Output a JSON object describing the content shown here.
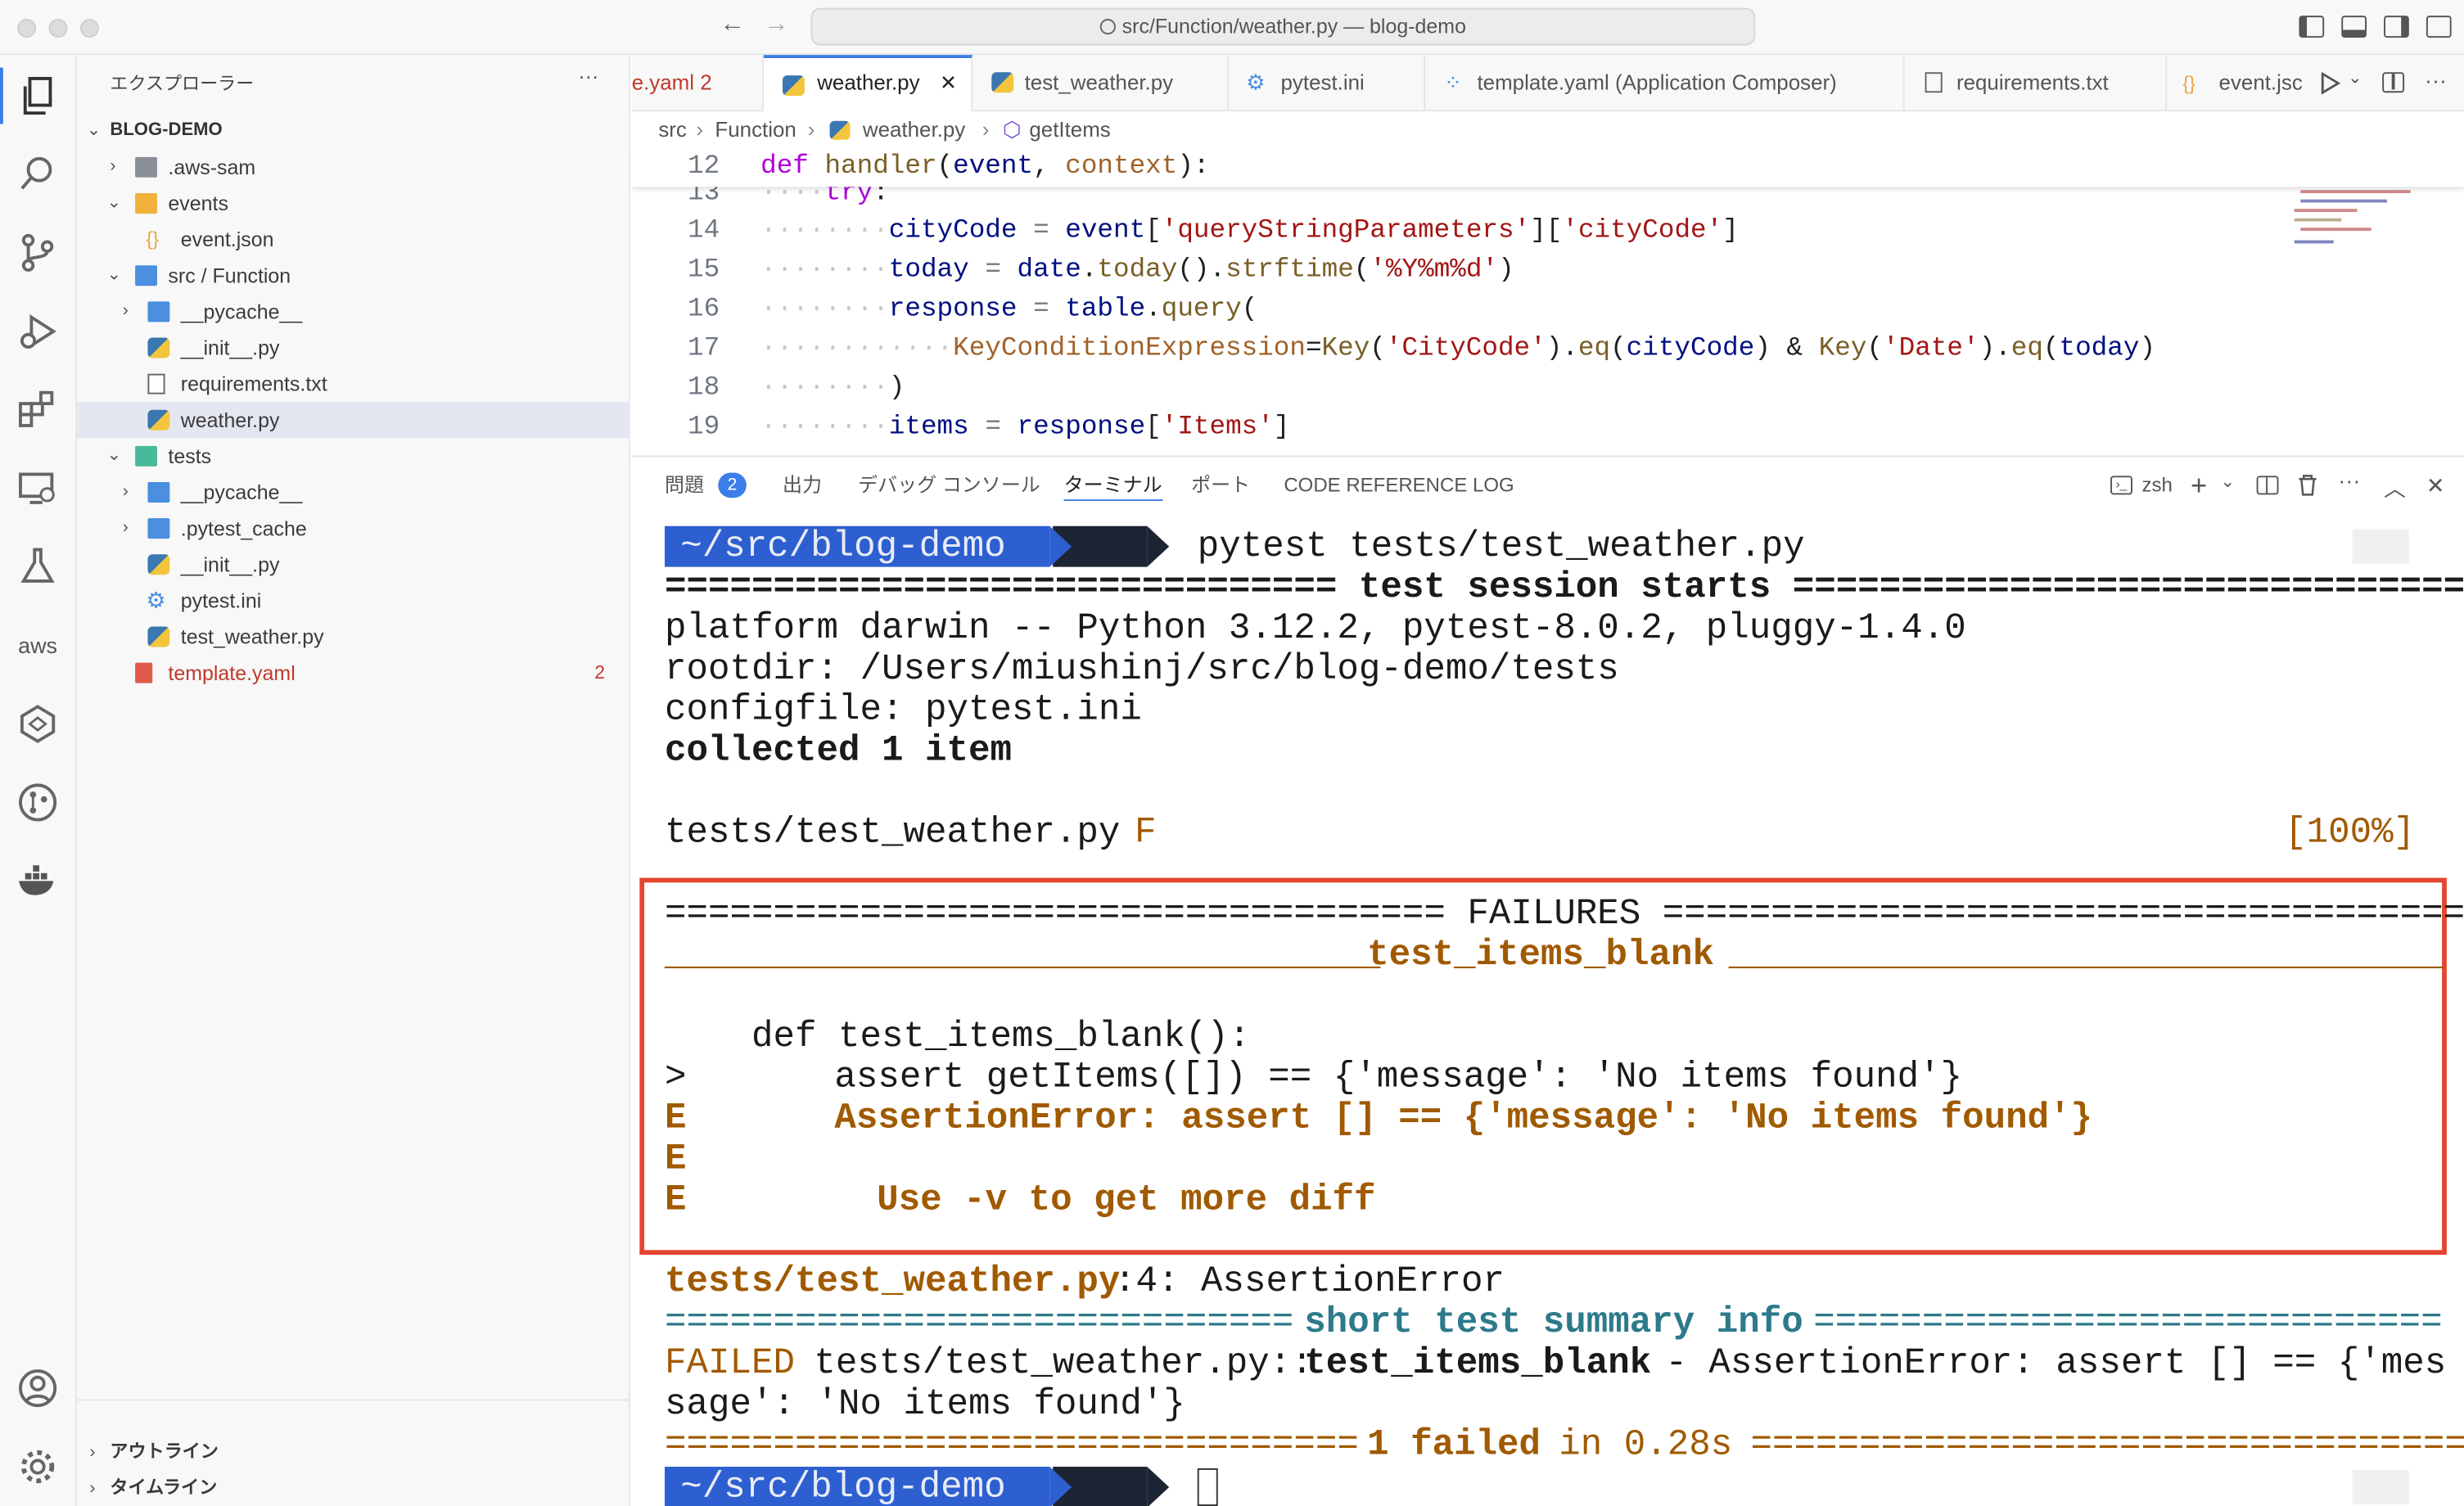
{
  "window": {
    "title": "src/Function/weather.py — blog-demo"
  },
  "sidebar": {
    "title": "エクスプローラー",
    "more": "···",
    "root": "BLOG-DEMO",
    "items": [
      {
        "label": ".aws-sam"
      },
      {
        "label": "events"
      },
      {
        "label": "event.json"
      },
      {
        "label": "src / Function"
      },
      {
        "label": "__pycache__"
      },
      {
        "label": "__init__.py"
      },
      {
        "label": "requirements.txt"
      },
      {
        "label": "weather.py"
      },
      {
        "label": "tests"
      },
      {
        "label": "__pycache__"
      },
      {
        "label": ".pytest_cache"
      },
      {
        "label": "__init__.py"
      },
      {
        "label": "pytest.ini"
      },
      {
        "label": "test_weather.py"
      },
      {
        "label": "template.yaml",
        "badge": "2"
      }
    ],
    "outline": "アウトライン",
    "timeline": "タイムライン"
  },
  "tabs": [
    {
      "label": "e.yaml",
      "badge": "2"
    },
    {
      "label": "weather.py",
      "close": "✕"
    },
    {
      "label": "test_weather.py"
    },
    {
      "label": "pytest.ini"
    },
    {
      "label": "template.yaml (Application Composer)"
    },
    {
      "label": "requirements.txt"
    },
    {
      "label": "event.jsc"
    }
  ],
  "breadcrumb": {
    "p1": "src",
    "p2": "Function",
    "p3": "weather.py",
    "p4": "getItems"
  },
  "code": {
    "lines": [
      {
        "n": "12",
        "text": "def handler(event, context):"
      },
      {
        "n": "13",
        "text": "try:"
      },
      {
        "n": "14",
        "text": "cityCode = event['queryStringParameters']['cityCode']"
      },
      {
        "n": "15",
        "text": "today = date.today().strftime('%Y%m%d')"
      },
      {
        "n": "16",
        "text": "response = table.query("
      },
      {
        "n": "17",
        "text": "KeyConditionExpression=Key('CityCode').eq(cityCode) & Key('Date').eq(today)"
      },
      {
        "n": "18",
        "text": ")"
      },
      {
        "n": "19",
        "text": "items = response['Items']"
      }
    ]
  },
  "panel": {
    "tabs": {
      "problems": "問題",
      "problems_count": "2",
      "output": "出力",
      "debug": "デバッグ コンソール",
      "terminal": "ターミナル",
      "ports": "ポート",
      "codelog": "CODE REFERENCE LOG"
    },
    "shell": "zsh"
  },
  "terminal": {
    "prompt_path": "~/src/blog-demo",
    "command": "pytest tests/test_weather.py",
    "l_session": "=============================== test session starts ===============================",
    "l_platform": "platform darwin -- Python 3.12.2, pytest-8.0.2, pluggy-1.4.0",
    "l_rootdir": "rootdir: /Users/miushinj/src/blog-demo/tests",
    "l_config": "configfile: pytest.ini",
    "l_collected": "collected 1 item",
    "l_file": "tests/test_weather.py",
    "l_file_result": "F",
    "l_percent": "[100%]",
    "l_failures": "==================================== FAILURES =====================================",
    "l_testname_left": "_________________________________",
    "l_testname": "test_items_blank",
    "l_testname_right": "_________________________________",
    "l_def": "    def test_items_blank():",
    "l_gt": ">",
    "l_assert": "assert getItems([]) == {'message': 'No items found'}",
    "l_e1": "E",
    "l_err": "AssertionError: assert [] == {'message': 'No items found'}",
    "l_e2": "E",
    "l_e3": "E",
    "l_diff": "Use -v to get more diff",
    "l_loc_file": "tests/test_weather.py",
    "l_loc_rest": ":4: AssertionError",
    "l_summary_left": "=============================",
    "l_summary": "short test summary info",
    "l_summary_right": "=============================",
    "l_failed_kw": "FAILED",
    "l_failed_path": "tests/test_weather.py::",
    "l_failed_test": "test_items_blank",
    "l_failed_msg": " - AssertionError: assert [] == {'mes",
    "l_failed_wrap": "sage': 'No items found'}",
    "l_result_left": "================================",
    "l_result_count": "1 failed",
    "l_result_time": "in 0.28s",
    "l_result_right": "================================="
  }
}
